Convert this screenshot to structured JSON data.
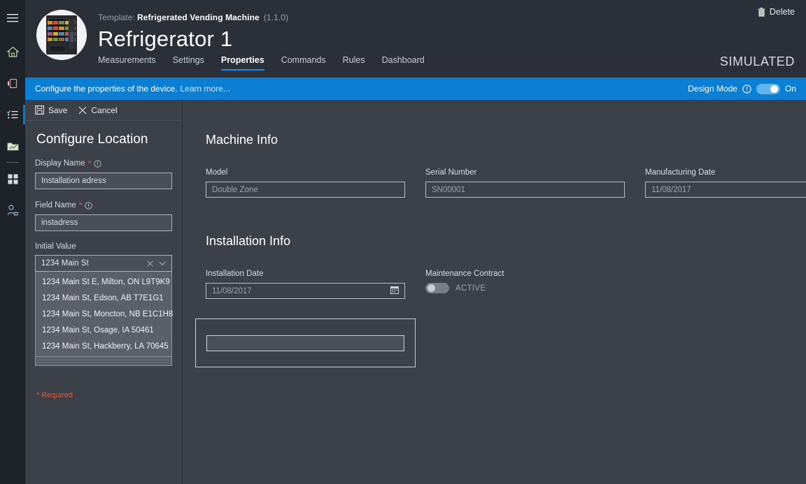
{
  "rail": {
    "items": [
      {
        "name": "menu-icon",
        "label": "Menu"
      },
      {
        "name": "home-icon",
        "label": "Home"
      },
      {
        "name": "devices-icon",
        "label": "Devices"
      },
      {
        "name": "device-groups-icon",
        "label": "Device groups"
      },
      {
        "name": "analytics-icon",
        "label": "Analytics"
      },
      {
        "name": "dashboards-icon",
        "label": "Dashboards"
      },
      {
        "name": "users-icon",
        "label": "Users"
      }
    ]
  },
  "header": {
    "template_label": "Template:",
    "template_name": "Refrigerated Vending Machine",
    "template_version": "(1.1.0)",
    "title": "Refrigerator 1",
    "simulated_badge": "SIMULATED",
    "delete_label": "Delete",
    "avatar_alt": "vending-machine-photo",
    "tabs": [
      {
        "label": "Measurements",
        "active": false
      },
      {
        "label": "Settings",
        "active": false
      },
      {
        "label": "Properties",
        "active": true
      },
      {
        "label": "Commands",
        "active": false
      },
      {
        "label": "Rules",
        "active": false
      },
      {
        "label": "Dashboard",
        "active": false
      }
    ]
  },
  "infobar": {
    "message": "Configure the properties of the device.",
    "learn_more": "Learn more...",
    "design_mode_label": "Design Mode",
    "design_mode_state": "On",
    "accent_color": "#0b7fd4"
  },
  "config_panel": {
    "save_label": "Save",
    "cancel_label": "Cancel",
    "title": "Configure Location",
    "display_name": {
      "label": "Display Name",
      "required_mark": "*",
      "value": "Installation adress"
    },
    "field_name": {
      "label": "Field Name",
      "required_mark": "*",
      "value": "instadress"
    },
    "initial_value": {
      "label": "Initial Value",
      "value": "1234 Main St",
      "options": [
        "1234 Main St E, Milton, ON L9T9K9",
        "1234 Main St, Edson, AB T7E1G1",
        "1234 Main St, Moncton, NB E1C1H8",
        "1234 Main St, Osage, IA 50461",
        "1234 Main St, Hackberry, LA 70645"
      ]
    },
    "required_note": "* Required",
    "required_color": "#e05a3f"
  },
  "main": {
    "machine_info": {
      "title": "Machine Info",
      "fields": [
        {
          "label": "Model",
          "value": "Double Zone"
        },
        {
          "label": "Serial Number",
          "value": "SN00001"
        },
        {
          "label": "Manufacturing Date",
          "value": "11/08/2017"
        }
      ]
    },
    "installation_info": {
      "title": "Installation Info",
      "date_field": {
        "label": "Installation Date",
        "value": "11/08/2017"
      },
      "toggle_field": {
        "label": "Maintenance Contract",
        "state": "ACTIVE"
      }
    },
    "dropzone": {
      "name": "empty-property-placeholder"
    }
  }
}
